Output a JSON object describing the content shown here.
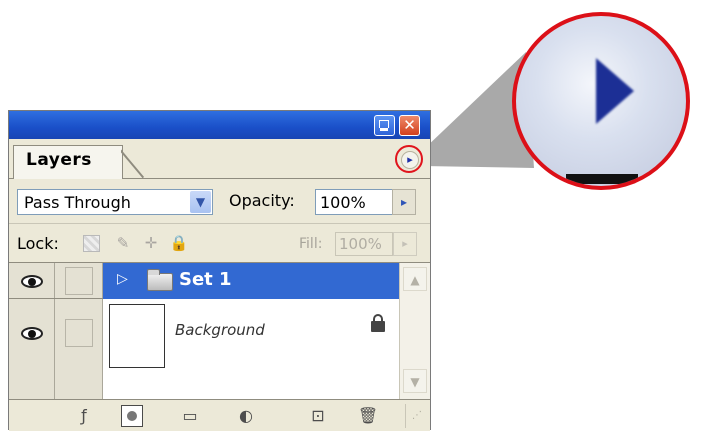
{
  "panel": {
    "window_buttons": {
      "minimize": "",
      "close": "✕"
    },
    "tab": "Layers",
    "menu_icon": "▸",
    "blend_mode": {
      "value": "Pass Through",
      "arrow": "▼"
    },
    "opacity": {
      "label": "Opacity:",
      "value": "100%",
      "arrow": "▸"
    },
    "lock": {
      "label": "Lock:",
      "paint_icon": "✎",
      "move_icon": "✛",
      "all_icon": "🔒"
    },
    "fill": {
      "label": "Fill:",
      "value": "100%",
      "arrow": "▸"
    },
    "layers": [
      {
        "name": "Set 1",
        "type": "set",
        "selected": true,
        "visible": true,
        "expand_icon": "▷"
      },
      {
        "name": "Background",
        "type": "layer",
        "selected": false,
        "visible": true,
        "locked": true
      }
    ],
    "scroll": {
      "up": "▲",
      "down": "▼"
    },
    "toolbar": {
      "style_icon": "ƒ",
      "newset_icon": "▭",
      "adjust_icon": "◐",
      "newlayer_icon": "⊡",
      "trash_icon": "🗑",
      "grip_icon": "⋰"
    }
  },
  "colors": {
    "selection": "#3269d2",
    "callout_ring": "#dc1018",
    "titlebar": "#1a4fc8"
  }
}
